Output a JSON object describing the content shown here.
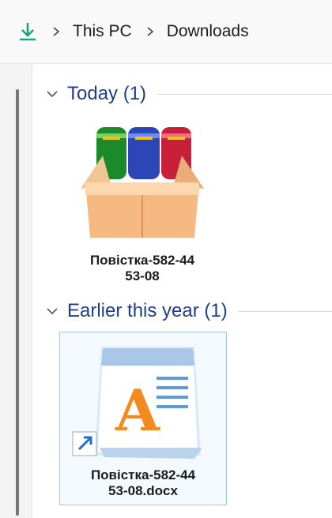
{
  "breadcrumb": {
    "icon": "download-icon",
    "items": [
      "This PC",
      "Downloads"
    ]
  },
  "groups": [
    {
      "title": "Today (1)",
      "files": [
        {
          "name_line1": "Повістка-582-44",
          "name_line2": "53-08",
          "icon": "archive-box-icon"
        }
      ]
    },
    {
      "title": "Earlier this year (1)",
      "files": [
        {
          "name_line1": "Повістка-582-44",
          "name_line2": "53-08.docx",
          "icon": "wordpad-document-icon",
          "shortcut": true
        }
      ]
    }
  ],
  "colors": {
    "group_title": "#1f3d8a",
    "download_arrow": "#1aa37a",
    "selection_border": "#99c7ee"
  }
}
